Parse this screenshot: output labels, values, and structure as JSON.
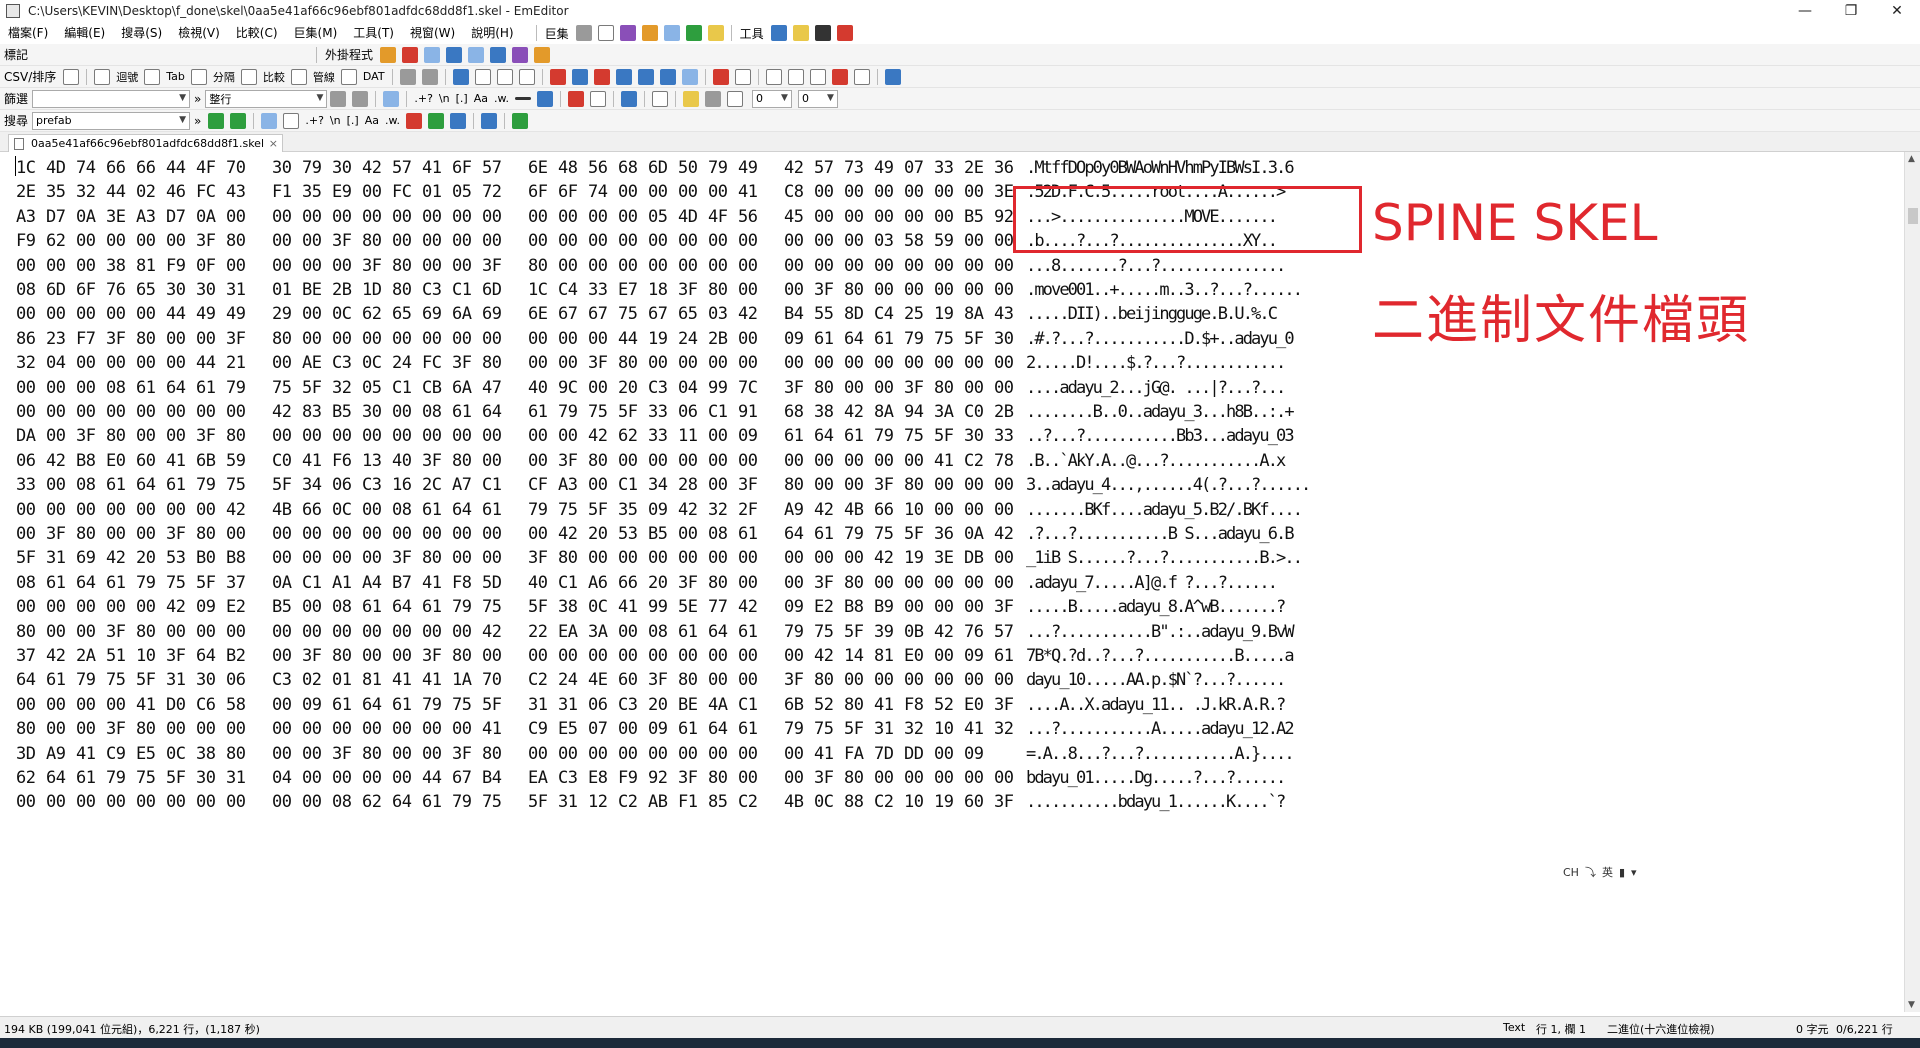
{
  "window": {
    "title": "C:\\Users\\KEVIN\\Desktop\\f_done\\skel\\0aa5e41af66c96ebf801adfdc68dd8f1.skel - EmEditor",
    "minimize": "—",
    "maximize": "❐",
    "close": "✕"
  },
  "menu": {
    "items": [
      "檔案(F)",
      "編輯(E)",
      "搜尋(S)",
      "檢視(V)",
      "比較(C)",
      "巨集(M)",
      "工具(T)",
      "視窗(W)",
      "說明(H)"
    ],
    "macros_label": "巨集",
    "tools_label": "工具"
  },
  "toolbars": {
    "bookmark_label": "標記",
    "external_tools_label": "外掛程式",
    "csv_label": "CSV/排序",
    "csv_buttons": [
      "迴號",
      "Tab",
      "分隔",
      "比較",
      "管線",
      "DAT"
    ],
    "filter_label": "篩選",
    "filter_value": "",
    "filter_mode": "整行",
    "search_label": "搜尋",
    "search_value": "prefab",
    "regex_label": ".+?",
    "newline_label": "\\n",
    "bracket_label": "[.]",
    "case_label": "Aa",
    "word_label": ".w.",
    "zero_1": "0",
    "zero_2": "0"
  },
  "tab": {
    "filename": "0aa5e41af66c96ebf801adfdc68dd8f1.skel",
    "close": "×"
  },
  "hex_rows": [
    {
      "hex": [
        "1C",
        "4D",
        "74",
        "66",
        "66",
        "44",
        "4F",
        "70",
        "30",
        "79",
        "30",
        "42",
        "57",
        "41",
        "6F",
        "57",
        "6E",
        "48",
        "56",
        "68",
        "6D",
        "50",
        "79",
        "49",
        "42",
        "57",
        "73",
        "49",
        "07",
        "33",
        "2E",
        "36"
      ],
      "ascii": ".MtffDOp0y0BWAoWnHVhmPyIBWsI.3.6"
    },
    {
      "hex": [
        "2E",
        "35",
        "32",
        "44",
        "02",
        "46",
        "FC",
        "43",
        "F1",
        "35",
        "E9",
        "00",
        "FC",
        "01",
        "05",
        "72",
        "6F",
        "6F",
        "74",
        "00",
        "00",
        "00",
        "00",
        "41",
        "C8",
        "00",
        "00",
        "00",
        "00",
        "00",
        "00",
        "3E"
      ],
      "ascii": ".52D.F.C.5.....root....A......>"
    },
    {
      "hex": [
        "A3",
        "D7",
        "0A",
        "3E",
        "A3",
        "D7",
        "0A",
        "00",
        "00",
        "00",
        "00",
        "00",
        "00",
        "00",
        "00",
        "00",
        "00",
        "00",
        "00",
        "00",
        "05",
        "4D",
        "4F",
        "56",
        "45",
        "00",
        "00",
        "00",
        "00",
        "00",
        "B5",
        "92"
      ],
      "ascii": "...>...............MOVE......."
    },
    {
      "hex": [
        "F9",
        "62",
        "00",
        "00",
        "00",
        "00",
        "3F",
        "80",
        "00",
        "00",
        "3F",
        "80",
        "00",
        "00",
        "00",
        "00",
        "00",
        "00",
        "00",
        "00",
        "00",
        "00",
        "00",
        "00",
        "00",
        "00",
        "00",
        "03",
        "58",
        "59",
        "00",
        "00"
      ],
      "ascii": ".b....?...?...............XY.."
    },
    {
      "hex": [
        "00",
        "00",
        "00",
        "38",
        "81",
        "F9",
        "0F",
        "00",
        "00",
        "00",
        "00",
        "3F",
        "80",
        "00",
        "00",
        "3F",
        "80",
        "00",
        "00",
        "00",
        "00",
        "00",
        "00",
        "00",
        "00",
        "00",
        "00",
        "00",
        "00",
        "00",
        "00",
        "00"
      ],
      "ascii": "...8.......?...?..............."
    },
    {
      "hex": [
        "08",
        "6D",
        "6F",
        "76",
        "65",
        "30",
        "30",
        "31",
        "01",
        "BE",
        "2B",
        "1D",
        "80",
        "C3",
        "C1",
        "6D",
        "1C",
        "C4",
        "33",
        "E7",
        "18",
        "3F",
        "80",
        "00",
        "00",
        "3F",
        "80",
        "00",
        "00",
        "00",
        "00",
        "00"
      ],
      "ascii": ".move001..+.....m..3..?...?......"
    },
    {
      "hex": [
        "00",
        "00",
        "00",
        "00",
        "00",
        "44",
        "49",
        "49",
        "29",
        "00",
        "0C",
        "62",
        "65",
        "69",
        "6A",
        "69",
        "6E",
        "67",
        "67",
        "75",
        "67",
        "65",
        "03",
        "42",
        "B4",
        "55",
        "8D",
        "C4",
        "25",
        "19",
        "8A",
        "43"
      ],
      "ascii": ".....DII)..beijingguge.B.U.%.C"
    },
    {
      "hex": [
        "86",
        "23",
        "F7",
        "3F",
        "80",
        "00",
        "00",
        "3F",
        "80",
        "00",
        "00",
        "00",
        "00",
        "00",
        "00",
        "00",
        "00",
        "00",
        "00",
        "44",
        "19",
        "24",
        "2B",
        "00",
        "09",
        "61",
        "64",
        "61",
        "79",
        "75",
        "5F",
        "30"
      ],
      "ascii": ".#.?...?...........D.$+..adayu_0"
    },
    {
      "hex": [
        "32",
        "04",
        "00",
        "00",
        "00",
        "00",
        "44",
        "21",
        "00",
        "AE",
        "C3",
        "0C",
        "24",
        "FC",
        "3F",
        "80",
        "00",
        "00",
        "3F",
        "80",
        "00",
        "00",
        "00",
        "00",
        "00",
        "00",
        "00",
        "00",
        "00",
        "00",
        "00",
        "00"
      ],
      "ascii": "2.....D!....$.?...?............"
    },
    {
      "hex": [
        "00",
        "00",
        "00",
        "08",
        "61",
        "64",
        "61",
        "79",
        "75",
        "5F",
        "32",
        "05",
        "C1",
        "CB",
        "6A",
        "47",
        "40",
        "9C",
        "00",
        "20",
        "C3",
        "04",
        "99",
        "7C",
        "3F",
        "80",
        "00",
        "00",
        "3F",
        "80",
        "00",
        "00"
      ],
      "ascii": "....adayu_2...jG@. ...|?...?..."
    },
    {
      "hex": [
        "00",
        "00",
        "00",
        "00",
        "00",
        "00",
        "00",
        "00",
        "42",
        "83",
        "B5",
        "30",
        "00",
        "08",
        "61",
        "64",
        "61",
        "79",
        "75",
        "5F",
        "33",
        "06",
        "C1",
        "91",
        "68",
        "38",
        "42",
        "8A",
        "94",
        "3A",
        "C0",
        "2B"
      ],
      "ascii": "........B..0..adayu_3...h8B..:.+"
    },
    {
      "hex": [
        "DA",
        "00",
        "3F",
        "80",
        "00",
        "00",
        "3F",
        "80",
        "00",
        "00",
        "00",
        "00",
        "00",
        "00",
        "00",
        "00",
        "00",
        "00",
        "42",
        "62",
        "33",
        "11",
        "00",
        "09",
        "61",
        "64",
        "61",
        "79",
        "75",
        "5F",
        "30",
        "33"
      ],
      "ascii": "..?...?...........Bb3...adayu_03"
    },
    {
      "hex": [
        "06",
        "42",
        "B8",
        "E0",
        "60",
        "41",
        "6B",
        "59",
        "C0",
        "41",
        "F6",
        "13",
        "40",
        "3F",
        "80",
        "00",
        "00",
        "3F",
        "80",
        "00",
        "00",
        "00",
        "00",
        "00",
        "00",
        "00",
        "00",
        "00",
        "00",
        "41",
        "C2",
        "78"
      ],
      "ascii": ".B..`AkY.A..@...?...........A.x"
    },
    {
      "hex": [
        "33",
        "00",
        "08",
        "61",
        "64",
        "61",
        "79",
        "75",
        "5F",
        "34",
        "06",
        "C3",
        "16",
        "2C",
        "A7",
        "C1",
        "CF",
        "A3",
        "00",
        "C1",
        "34",
        "28",
        "00",
        "3F",
        "80",
        "00",
        "00",
        "3F",
        "80",
        "00",
        "00",
        "00"
      ],
      "ascii": "3..adayu_4...,......4(.?...?......"
    },
    {
      "hex": [
        "00",
        "00",
        "00",
        "00",
        "00",
        "00",
        "00",
        "42",
        "4B",
        "66",
        "0C",
        "00",
        "08",
        "61",
        "64",
        "61",
        "79",
        "75",
        "5F",
        "35",
        "09",
        "42",
        "32",
        "2F",
        "A9",
        "42",
        "4B",
        "66",
        "10",
        "00",
        "00",
        "00"
      ],
      "ascii": ".......BKf....adayu_5.B2/.BKf...."
    },
    {
      "hex": [
        "00",
        "3F",
        "80",
        "00",
        "00",
        "3F",
        "80",
        "00",
        "00",
        "00",
        "00",
        "00",
        "00",
        "00",
        "00",
        "00",
        "00",
        "42",
        "20",
        "53",
        "B5",
        "00",
        "08",
        "61",
        "64",
        "61",
        "79",
        "75",
        "5F",
        "36",
        "0A",
        "42"
      ],
      "ascii": ".?...?...........B S...adayu_6.B"
    },
    {
      "hex": [
        "5F",
        "31",
        "69",
        "42",
        "20",
        "53",
        "B0",
        "B8",
        "00",
        "00",
        "00",
        "00",
        "3F",
        "80",
        "00",
        "00",
        "3F",
        "80",
        "00",
        "00",
        "00",
        "00",
        "00",
        "00",
        "00",
        "00",
        "00",
        "42",
        "19",
        "3E",
        "DB",
        "00"
      ],
      "ascii": "_1iB S......?...?...........B.>.."
    },
    {
      "hex": [
        "08",
        "61",
        "64",
        "61",
        "79",
        "75",
        "5F",
        "37",
        "0A",
        "C1",
        "A1",
        "A4",
        "B7",
        "41",
        "F8",
        "5D",
        "40",
        "C1",
        "A6",
        "66",
        "20",
        "3F",
        "80",
        "00",
        "00",
        "3F",
        "80",
        "00",
        "00",
        "00",
        "00",
        "00"
      ],
      "ascii": ".adayu_7.....A]@.f ?...?......"
    },
    {
      "hex": [
        "00",
        "00",
        "00",
        "00",
        "00",
        "42",
        "09",
        "E2",
        "B5",
        "00",
        "08",
        "61",
        "64",
        "61",
        "79",
        "75",
        "5F",
        "38",
        "0C",
        "41",
        "99",
        "5E",
        "77",
        "42",
        "09",
        "E2",
        "B8",
        "B9",
        "00",
        "00",
        "00",
        "3F"
      ],
      "ascii": ".....B.....adayu_8.A^wB.......?"
    },
    {
      "hex": [
        "80",
        "00",
        "00",
        "3F",
        "80",
        "00",
        "00",
        "00",
        "00",
        "00",
        "00",
        "00",
        "00",
        "00",
        "00",
        "42",
        "22",
        "EA",
        "3A",
        "00",
        "08",
        "61",
        "64",
        "61",
        "79",
        "75",
        "5F",
        "39",
        "0B",
        "42",
        "76",
        "57"
      ],
      "ascii": "...?...........B\".:..adayu_9.BvW"
    },
    {
      "hex": [
        "37",
        "42",
        "2A",
        "51",
        "10",
        "3F",
        "64",
        "B2",
        "00",
        "3F",
        "80",
        "00",
        "00",
        "3F",
        "80",
        "00",
        "00",
        "00",
        "00",
        "00",
        "00",
        "00",
        "00",
        "00",
        "00",
        "42",
        "14",
        "81",
        "E0",
        "00",
        "09",
        "61"
      ],
      "ascii": "7B*Q.?d..?...?...........B.....a"
    },
    {
      "hex": [
        "64",
        "61",
        "79",
        "75",
        "5F",
        "31",
        "30",
        "06",
        "C3",
        "02",
        "01",
        "81",
        "41",
        "41",
        "1A",
        "70",
        "C2",
        "24",
        "4E",
        "60",
        "3F",
        "80",
        "00",
        "00",
        "3F",
        "80",
        "00",
        "00",
        "00",
        "00",
        "00",
        "00"
      ],
      "ascii": "dayu_10.....AA.p.$N`?...?......"
    },
    {
      "hex": [
        "00",
        "00",
        "00",
        "00",
        "41",
        "D0",
        "C6",
        "58",
        "00",
        "09",
        "61",
        "64",
        "61",
        "79",
        "75",
        "5F",
        "31",
        "31",
        "06",
        "C3",
        "20",
        "BE",
        "4A",
        "C1",
        "6B",
        "52",
        "80",
        "41",
        "F8",
        "52",
        "E0",
        "3F"
      ],
      "ascii": "....A..X.adayu_11.. .J.kR.A.R.?"
    },
    {
      "hex": [
        "80",
        "00",
        "00",
        "3F",
        "80",
        "00",
        "00",
        "00",
        "00",
        "00",
        "00",
        "00",
        "00",
        "00",
        "00",
        "41",
        "C9",
        "E5",
        "07",
        "00",
        "09",
        "61",
        "64",
        "61",
        "79",
        "75",
        "5F",
        "31",
        "32",
        "10",
        "41",
        "32"
      ],
      "ascii": "...?...........A.....adayu_12.A2"
    },
    {
      "hex": [
        "3D",
        "A9",
        "41",
        "C9",
        "E5",
        "0C",
        "38",
        "80",
        "00",
        "00",
        "3F",
        "80",
        "00",
        "00",
        "3F",
        "80",
        "00",
        "00",
        "00",
        "00",
        "00",
        "00",
        "00",
        "00",
        "00",
        "41",
        "FA",
        "7D",
        "DD",
        "00",
        "09"
      ],
      "ascii": "=.A..8...?...?...........A.}...."
    },
    {
      "hex": [
        "62",
        "64",
        "61",
        "79",
        "75",
        "5F",
        "30",
        "31",
        "04",
        "00",
        "00",
        "00",
        "00",
        "44",
        "67",
        "B4",
        "EA",
        "C3",
        "E8",
        "F9",
        "92",
        "3F",
        "80",
        "00",
        "00",
        "3F",
        "80",
        "00",
        "00",
        "00",
        "00",
        "00"
      ],
      "ascii": "bdayu_01.....Dg.....?...?......"
    },
    {
      "hex": [
        "00",
        "00",
        "00",
        "00",
        "00",
        "00",
        "00",
        "00",
        "00",
        "00",
        "08",
        "62",
        "64",
        "61",
        "79",
        "75",
        "5F",
        "31",
        "12",
        "C2",
        "AB",
        "F1",
        "85",
        "C2",
        "4B",
        "0C",
        "88",
        "C2",
        "10",
        "19",
        "60",
        "3F"
      ],
      "ascii": "...........bdayu_1......K....`?"
    }
  ],
  "annotation": {
    "title": "SPINE SKEL",
    "subtitle": "二進制文件檔頭",
    "color": "#e0282e"
  },
  "ime": {
    "items": [
      "CH",
      "⤵",
      "英",
      "▮",
      "▾"
    ]
  },
  "status": {
    "size": "194 KB (199,041 位元組)，6,221 行，(1,187 秒)",
    "mode": "Text",
    "position": "行 1, 欄 1",
    "encoding": "二進位(十六進位檢視)",
    "selection": "0 字元",
    "lines": "0/6,221 行"
  }
}
